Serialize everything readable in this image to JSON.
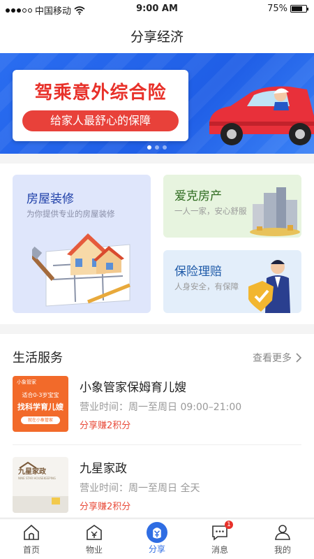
{
  "status_bar": {
    "carrier": "中国移动",
    "time": "9:00 AM",
    "battery_percent": "75%",
    "battery_level": 0.75
  },
  "nav": {
    "title": "分享经济"
  },
  "banner": {
    "title": "驾乘意外综合险",
    "subtitle": "给家人最舒心的保障",
    "slide_count": 3,
    "active_slide": 1
  },
  "cards": [
    {
      "title": "房屋装修",
      "desc": "为你提供专业的房屋装修"
    },
    {
      "title": "爱克房产",
      "desc": "一人一家，安心舒服"
    },
    {
      "title": "保险理赔",
      "desc": "人身安全，有保障"
    }
  ],
  "life": {
    "title": "生活服务",
    "more_label": "查看更多",
    "items": [
      {
        "name": "小象管家保姆育儿嫂",
        "hours": "营业时间：周一至周日 09:00–21:00",
        "reward": "分享赚2积分",
        "thumb_brand": "小象管家",
        "thumb_line1": "适合0-3岁宝宝",
        "thumb_line2": "找科学育儿嫂",
        "thumb_line3": "就在小象管家"
      },
      {
        "name": "九星家政",
        "hours": "营业时间：周一至周日 全天",
        "reward": "分享赚2积分",
        "thumb_brand": "九星家政",
        "thumb_sub": "NINE STAR HOUSEKEEPING"
      }
    ]
  },
  "tabs": [
    {
      "label": "首页",
      "icon": "home-icon"
    },
    {
      "label": "物业",
      "icon": "property-icon"
    },
    {
      "label": "分享",
      "icon": "share-icon",
      "active": true
    },
    {
      "label": "消息",
      "icon": "message-icon",
      "badge": "1"
    },
    {
      "label": "我的",
      "icon": "profile-icon"
    }
  ],
  "colors": {
    "accent": "#2f6de3",
    "reward": "#e84b3a",
    "banner_bg": "#2a6df0"
  }
}
